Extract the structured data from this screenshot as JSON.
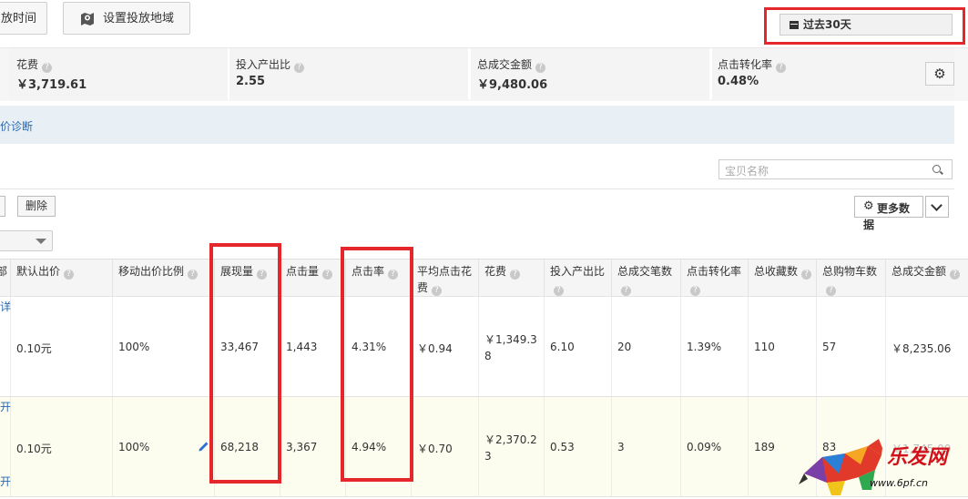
{
  "top_buttons": {
    "time_label": "放时间",
    "region_label": "设置投放地域",
    "date_range_label": "过去30天"
  },
  "stats": [
    {
      "label": "花费",
      "value": "￥3,719.61"
    },
    {
      "label": "投入产出比",
      "value": "2.55"
    },
    {
      "label": "总成交金额",
      "value": "￥9,480.06"
    },
    {
      "label": "点击转化率",
      "value": "0.48%"
    }
  ],
  "diagnosis_link": "价诊断",
  "search": {
    "placeholder": "宝贝名称"
  },
  "toolbar": {
    "delete_label": "删除",
    "more_data_line1": "更多数",
    "more_data_line2": "据"
  },
  "columns": [
    {
      "label": "部"
    },
    {
      "label": "默认出价"
    },
    {
      "label": "移动出价比例"
    },
    {
      "label": "展现量"
    },
    {
      "label": "点击量"
    },
    {
      "label": "点击率"
    },
    {
      "label": "平均点击花费"
    },
    {
      "label": "花费"
    },
    {
      "label": "投入产出比"
    },
    {
      "label": "总成交笔数"
    },
    {
      "label": "点击转化率"
    },
    {
      "label": "总收藏数"
    },
    {
      "label": "总购物车数"
    },
    {
      "label": "总成交金额"
    }
  ],
  "rows": [
    {
      "default_bid": "0.10元",
      "mobile_ratio": "100%",
      "impressions": "33,467",
      "clicks": "1,443",
      "ctr": "4.31%",
      "avg_cpc": "￥0.94",
      "cost": "￥1,349.38",
      "roi": "6.10",
      "orders": "20",
      "conv_rate": "1.39%",
      "favorites": "110",
      "cart": "57",
      "gmv": "￥8,235.06"
    },
    {
      "default_bid": "0.10元",
      "mobile_ratio": "100%",
      "impressions": "68,218",
      "clicks": "3,367",
      "ctr": "4.94%",
      "avg_cpc": "￥0.70",
      "cost": "￥2,370.23",
      "roi": "0.53",
      "orders": "3",
      "conv_rate": "0.09%",
      "favorites": "189",
      "cart": "83",
      "gmv": "￥1,745.00"
    }
  ],
  "edge_links": {
    "row1": "详",
    "row2_top": "开",
    "row2_bottom": "开"
  },
  "watermark": {
    "name": "乐发网",
    "url": "www.6pf.cn"
  },
  "colors": {
    "highlight": "#e5272b",
    "link": "#2867b4"
  }
}
